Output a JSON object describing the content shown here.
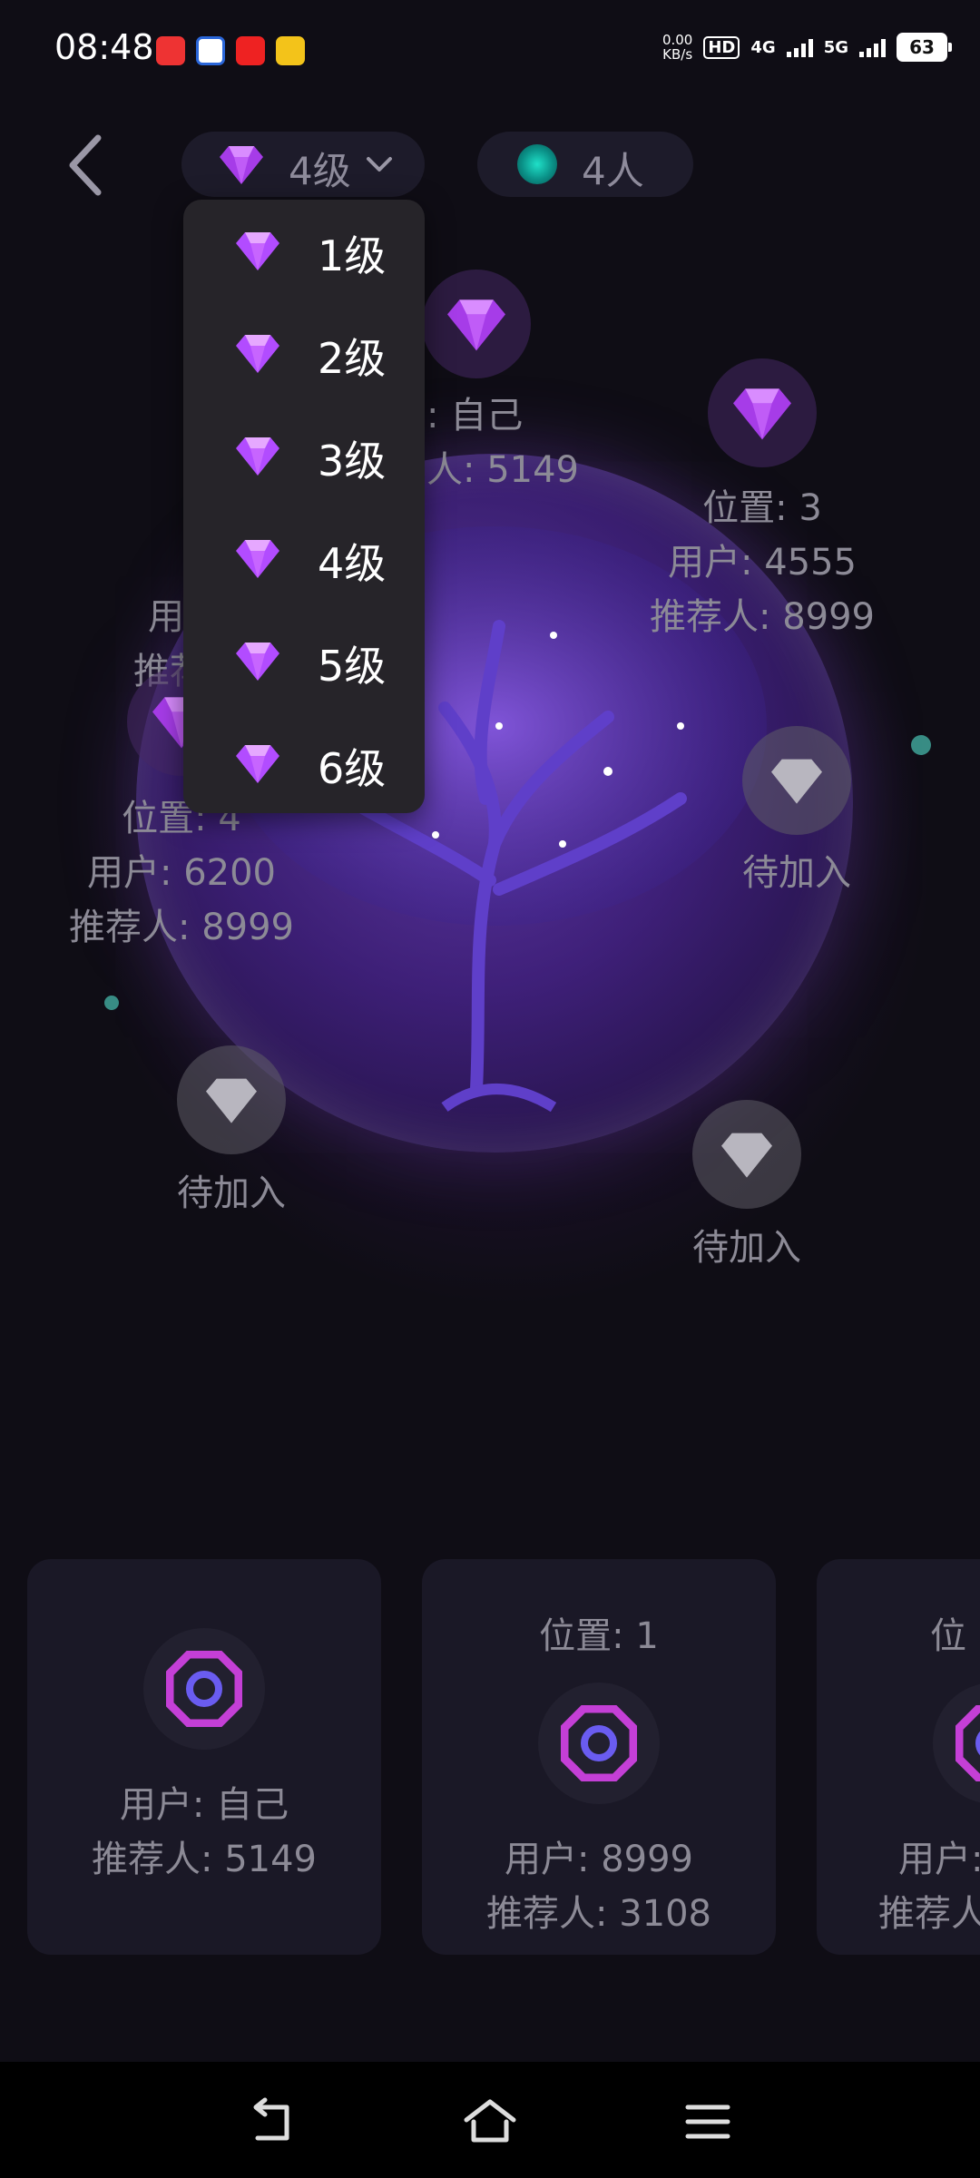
{
  "status_bar": {
    "time": "08:48",
    "net_speed_value": "0.00",
    "net_speed_unit": "KB/s",
    "hd_label": "HD",
    "sim1": "1",
    "sim2": "2",
    "network_4g": "4G",
    "network_5g": "5G",
    "battery": "63"
  },
  "header": {
    "level_selected": "4级",
    "people_count": "4人"
  },
  "dropdown": {
    "options": [
      "1级",
      "2级",
      "3级",
      "4级",
      "5级",
      "6级"
    ]
  },
  "tree_nodes": {
    "top": {
      "user": "户: 自己",
      "referrer": "荐人: 5149"
    },
    "right": {
      "position": "位置: 3",
      "user": "用户: 4555",
      "referrer": "推荐人: 8999"
    },
    "left": {
      "user_partial": "用",
      "referrer_partial": "推荐",
      "position": "位置: 4",
      "user": "用户: 6200",
      "referrer": "推荐人: 8999"
    },
    "empty_label": "待加入"
  },
  "cards": [
    {
      "user": "用户: 自己",
      "referrer": "推荐人: 5149"
    },
    {
      "position": "位置: 1",
      "user": "用户: 8999",
      "referrer": "推荐人: 3108"
    },
    {
      "position_partial": "位",
      "user_partial": "用户:",
      "referrer_partial": "推荐人"
    }
  ],
  "colors": {
    "background": "#0f0d15",
    "gem_purple": "#b24cff",
    "teal": "#1fe0c8",
    "dropdown_bg": "#262429"
  },
  "icons": {
    "back": "chevron-left-icon",
    "gem": "diamond-icon",
    "people": "teal-orb-icon",
    "chevron": "chevron-down-icon",
    "nav_back": "back-arrow-icon",
    "nav_home": "home-icon",
    "nav_menu": "menu-icon"
  }
}
